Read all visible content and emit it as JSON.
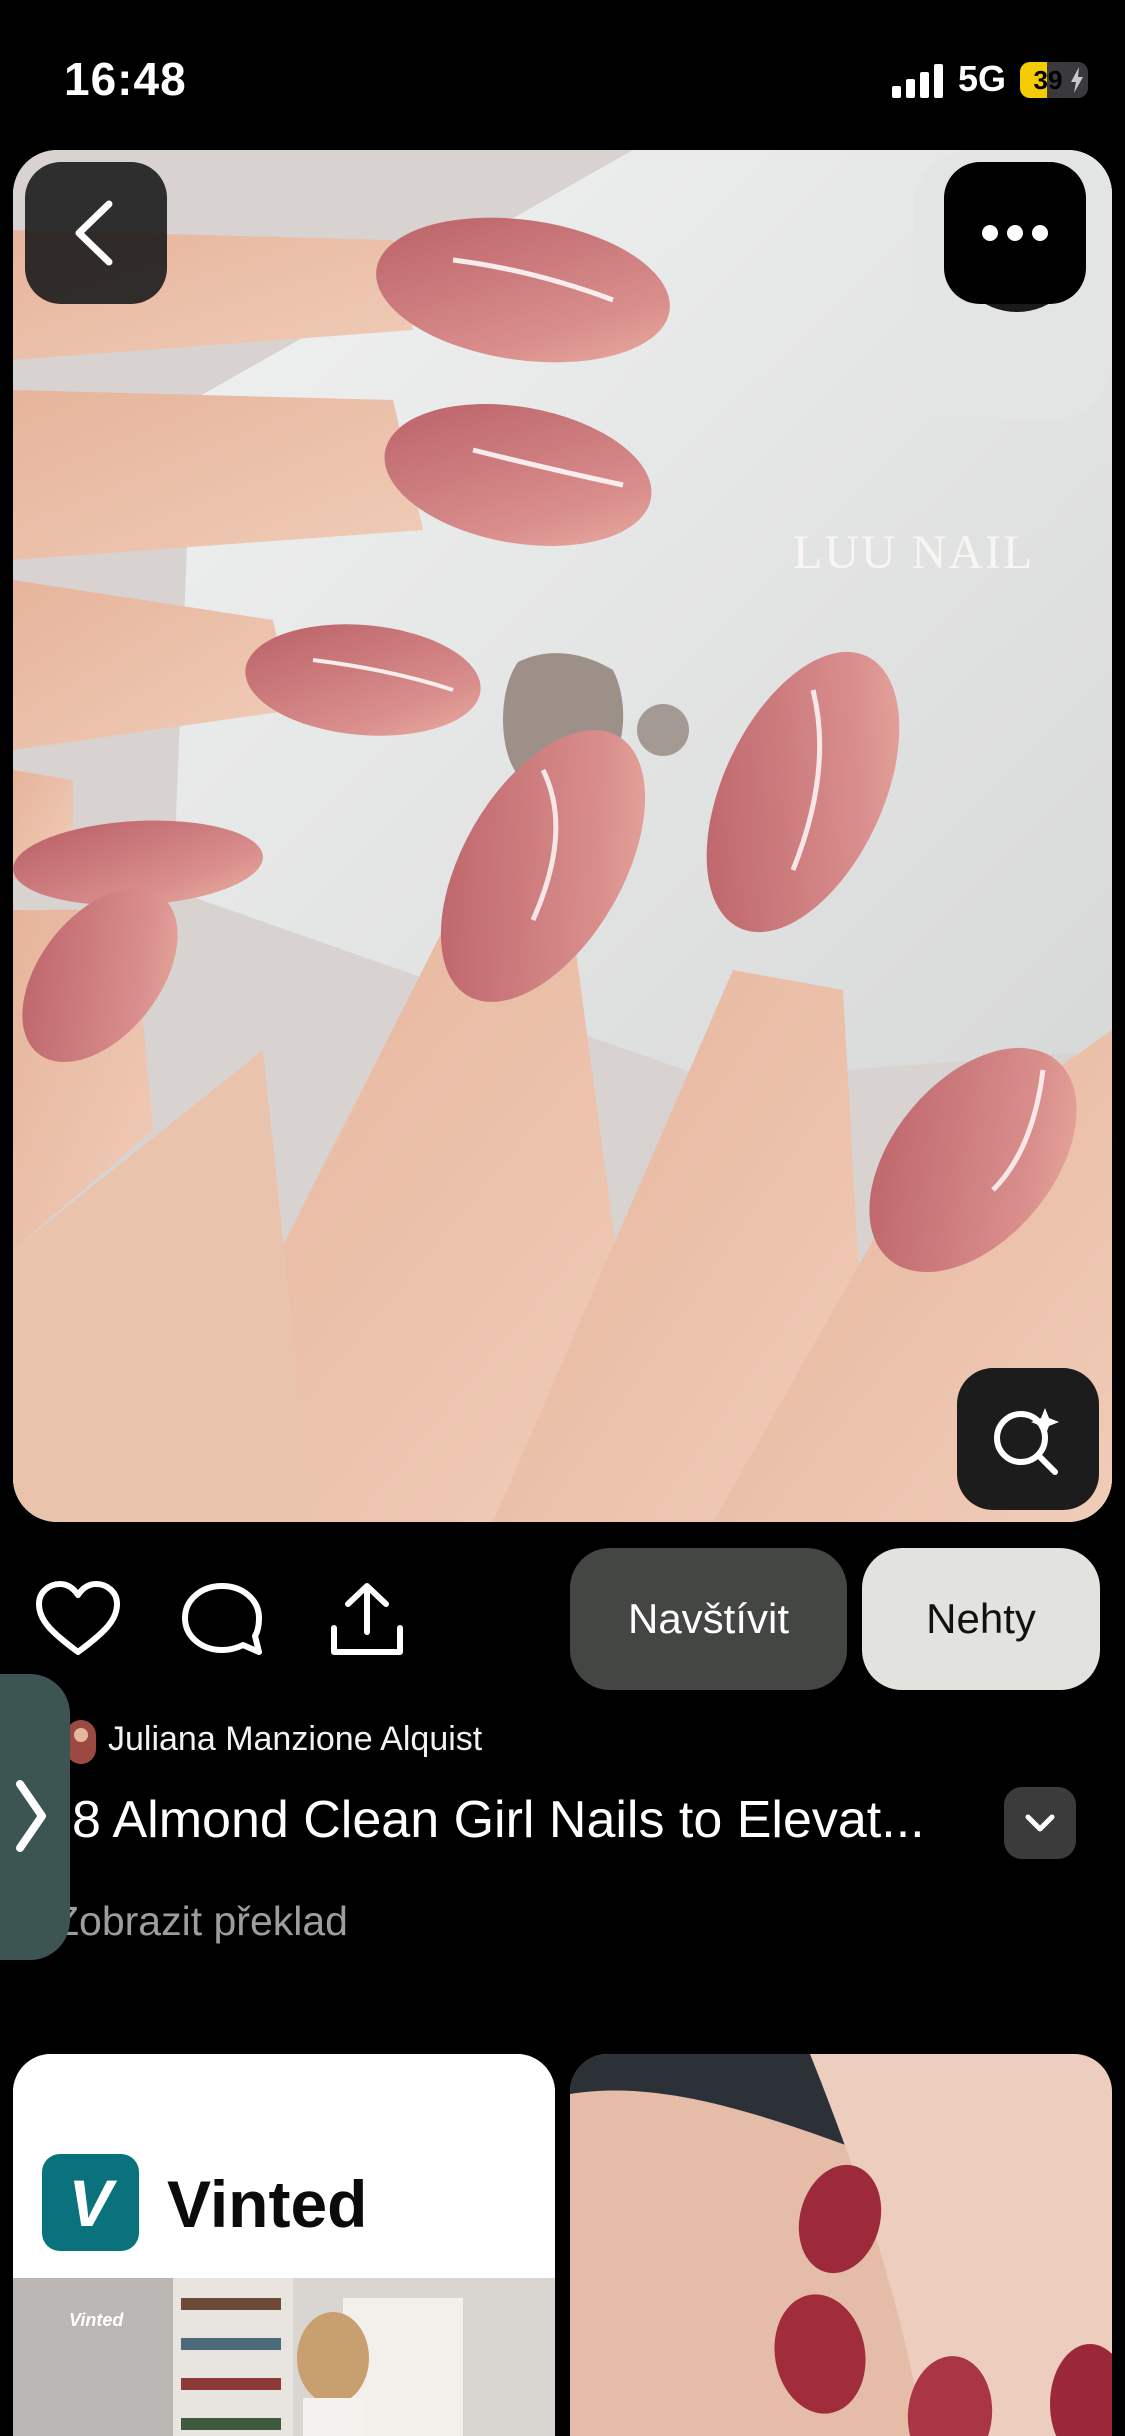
{
  "status_bar": {
    "time": "16:48",
    "network": "5G",
    "battery_percent": 39,
    "battery_label": "39",
    "charging": true
  },
  "pin": {
    "watermark": "LUU NAIL",
    "author": "Juliana Manzione Alquist",
    "title": "8 Almond Clean Girl Nails to Elevat...",
    "translate_link": "Zobrazit překlad",
    "visit_label": "Navštívit",
    "board_label": "Nehty"
  },
  "icons": {
    "back": "chevron-left-icon",
    "more": "more-horizontal-icon",
    "lens": "visual-search-icon",
    "like": "heart-icon",
    "comment": "comment-icon",
    "share": "share-icon",
    "expand": "chevron-down-icon",
    "side_tab": "chevron-right-icon"
  },
  "feed": {
    "ad": {
      "brand": "Vinted",
      "logo_letter": "V",
      "photo_brand": "Vinted"
    }
  },
  "colors": {
    "background": "#000000",
    "visit_button": "#444643",
    "board_button": "#e2e2de",
    "side_tab": "#3c5553",
    "vinted_teal": "#09727d",
    "battery": "#f5cc00",
    "nail_pink": "#c86f78"
  }
}
